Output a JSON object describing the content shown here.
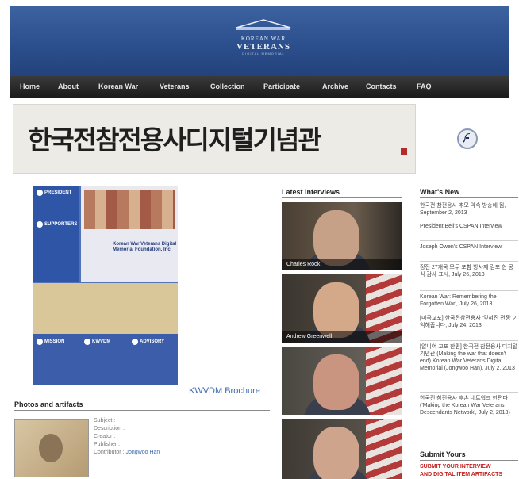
{
  "header": {
    "logo_line1": "KOREAN WAR",
    "logo_line2": "VETERANS",
    "logo_line3": "DIGITAL MEMORIAL"
  },
  "nav": {
    "items": [
      "Home",
      "About",
      "Korean War",
      "Veterans",
      "Collection",
      "Participate",
      "Archive",
      "Contacts",
      "FAQ"
    ]
  },
  "banner": {
    "calligraphy": "한국전참전용사디지털기념관"
  },
  "brochure": {
    "labels": [
      "PRESIDENT",
      "SUPPORTERS",
      "MISSION",
      "KWVDM",
      "ADVISORY"
    ],
    "title": "Korean War Veterans Digital Memorial Foundation, Inc.",
    "link_text": "KWVDM Brochure"
  },
  "photos": {
    "heading": "Photos and artifacts",
    "fields": [
      {
        "label": "Subject :",
        "value": ""
      },
      {
        "label": "Description :",
        "value": ""
      },
      {
        "label": "Creator :",
        "value": ""
      },
      {
        "label": "Publisher :",
        "value": ""
      },
      {
        "label": "Contributor :",
        "value": "Jongwoo Han"
      }
    ]
  },
  "interviews": {
    "heading": "Latest Interviews",
    "items": [
      {
        "name": "Charles Rook"
      },
      {
        "name": "Andrew Greenwell"
      },
      {
        "name": ""
      },
      {
        "name": ""
      }
    ]
  },
  "whats_new": {
    "heading": "What's New",
    "items": [
      "한국전 참전용사 추모 약속 방송에 됨, September 2, 2013",
      "President Bell's CSPAN Interview",
      "Joseph Owen's CSPAN Interview",
      "정전 27개국 모두 포함 방사제 김포 현 공식 감사 표시, July 26, 2013",
      "Korean War: Remembering the Forgotten War', July 26, 2013",
      "[미국교포] 한국전참전용사 '잊혀진 전쟁' 기억해줍니다, July 24, 2013",
      "[알니어 교포 한편] 한국전 참전용사 디지털 기념관 (Making the war that doesn't end) Korean War Veterans Digital Memorial (Jongwoo Han), July 2, 2013",
      "한국전 참전용사 후손 네트워크 한편다 ('Making the Korean War Veterans Descendants Network', July 2, 2013)"
    ]
  },
  "submit": {
    "heading": "Submit Yours",
    "link1": "SUBMIT YOUR INTERVIEW",
    "link2": "AND DIGITAL ITEM ARTIFACTS"
  }
}
